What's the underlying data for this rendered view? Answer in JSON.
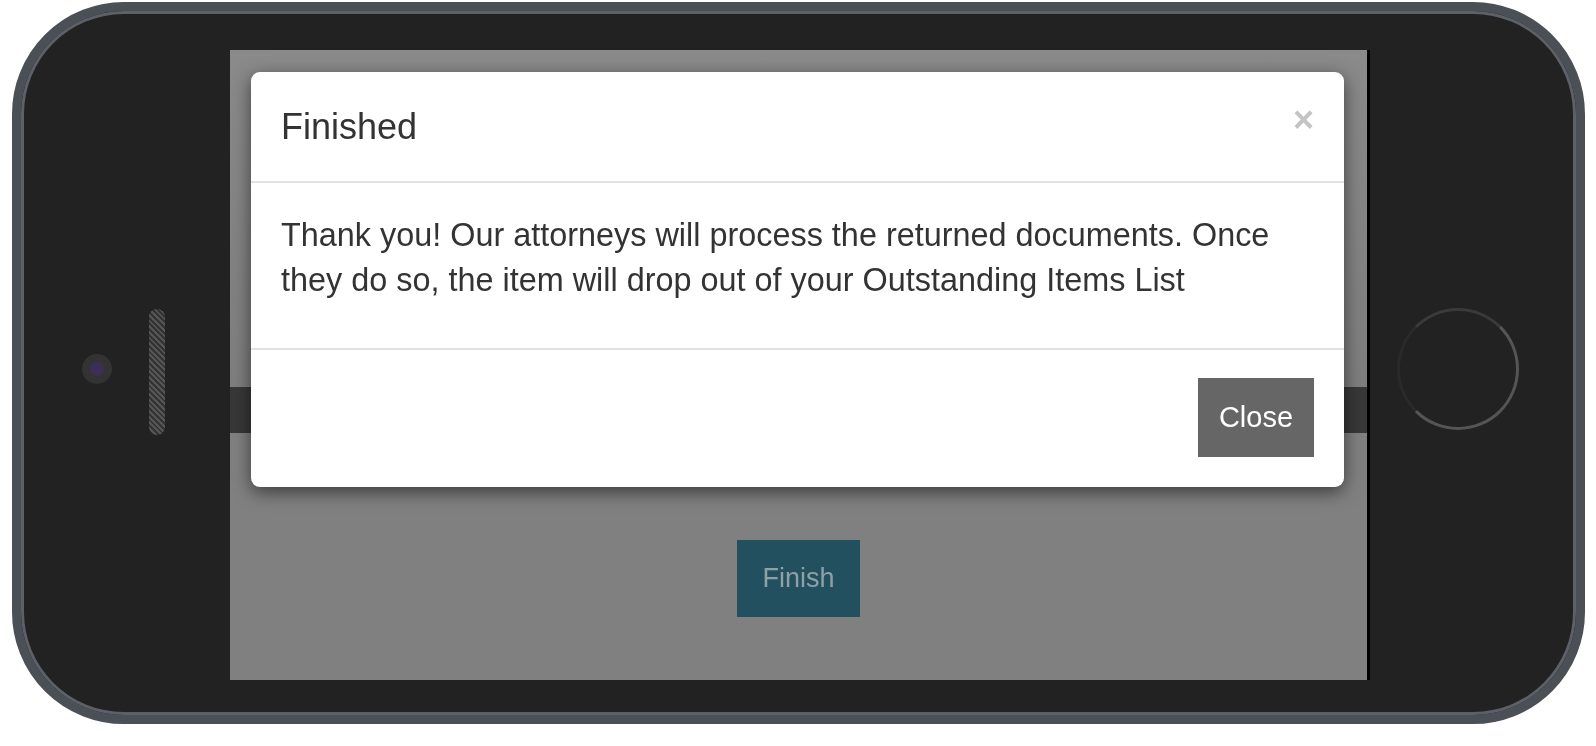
{
  "page": {
    "finish_button": "Finish"
  },
  "modal": {
    "title": "Finished",
    "close_icon": "×",
    "body": "Thank you! Our attorneys will process the returned documents. Once they do so, the item will drop out of your Outstanding Items List",
    "buttons": [
      "Close"
    ]
  }
}
